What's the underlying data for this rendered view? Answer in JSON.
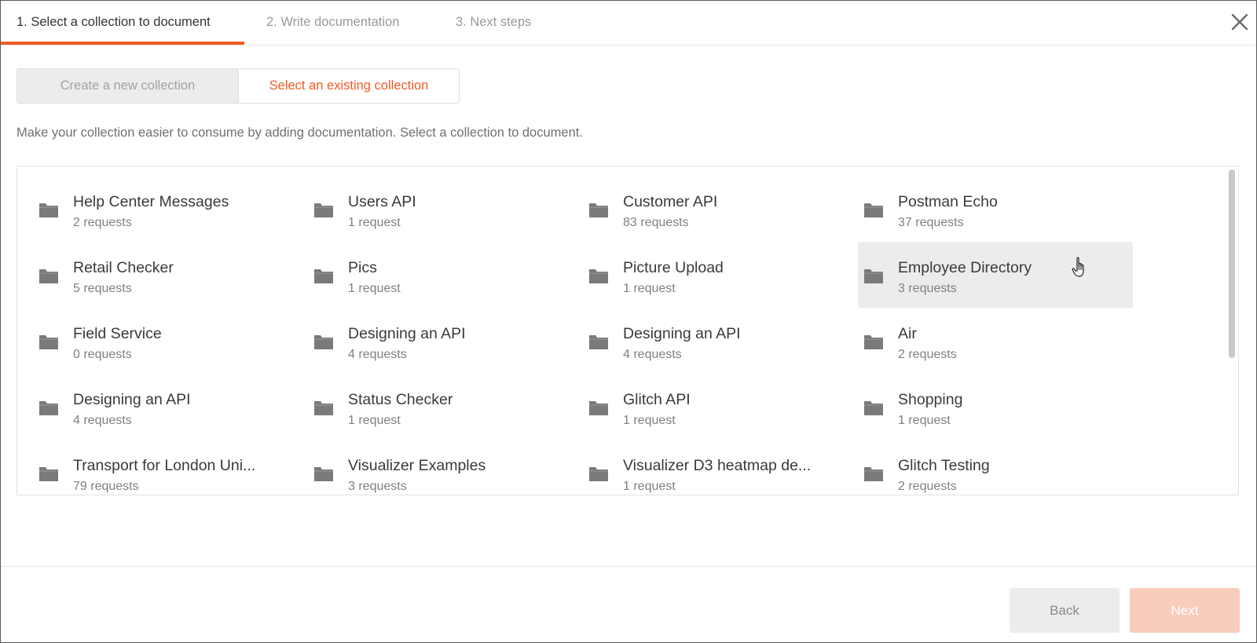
{
  "steps": [
    {
      "label": "1. Select a collection to document"
    },
    {
      "label": "2. Write documentation"
    },
    {
      "label": "3. Next steps"
    }
  ],
  "toggle": {
    "new_label": "Create a new collection",
    "existing_label": "Select an existing collection"
  },
  "description": "Make your collection easier to consume by adding documentation. Select a collection to document.",
  "collections": [
    {
      "name": "Help Center Messages",
      "count": "2 requests"
    },
    {
      "name": "Users API",
      "count": "1 request"
    },
    {
      "name": "Customer API",
      "count": "83 requests"
    },
    {
      "name": "Postman Echo",
      "count": "37 requests"
    },
    {
      "name": "Retail Checker",
      "count": "5 requests"
    },
    {
      "name": "Pics",
      "count": "1 request"
    },
    {
      "name": "Picture Upload",
      "count": "1 request"
    },
    {
      "name": "Employee Directory",
      "count": "3 requests"
    },
    {
      "name": "Field Service",
      "count": "0 requests"
    },
    {
      "name": "Designing an API",
      "count": "4 requests"
    },
    {
      "name": "Designing an API",
      "count": "4 requests"
    },
    {
      "name": "Air",
      "count": "2 requests"
    },
    {
      "name": "Designing an API",
      "count": "4 requests"
    },
    {
      "name": "Status Checker",
      "count": "1 request"
    },
    {
      "name": "Glitch API",
      "count": "1 request"
    },
    {
      "name": "Shopping",
      "count": "1 request"
    },
    {
      "name": "Transport for London Uni...",
      "count": "79 requests"
    },
    {
      "name": "Visualizer Examples",
      "count": "3 requests"
    },
    {
      "name": "Visualizer D3 heatmap de...",
      "count": "1 request"
    },
    {
      "name": "Glitch Testing",
      "count": "2 requests"
    }
  ],
  "footer": {
    "back_label": "Back",
    "next_label": "Next"
  },
  "colors": {
    "accent": "#ef5b25",
    "next_disabled": "#f9cdbb",
    "hover_card": "#ececec"
  },
  "icons": {
    "close": "close-icon",
    "folder": "folder-icon",
    "cursor": "hand-pointer-cursor"
  }
}
